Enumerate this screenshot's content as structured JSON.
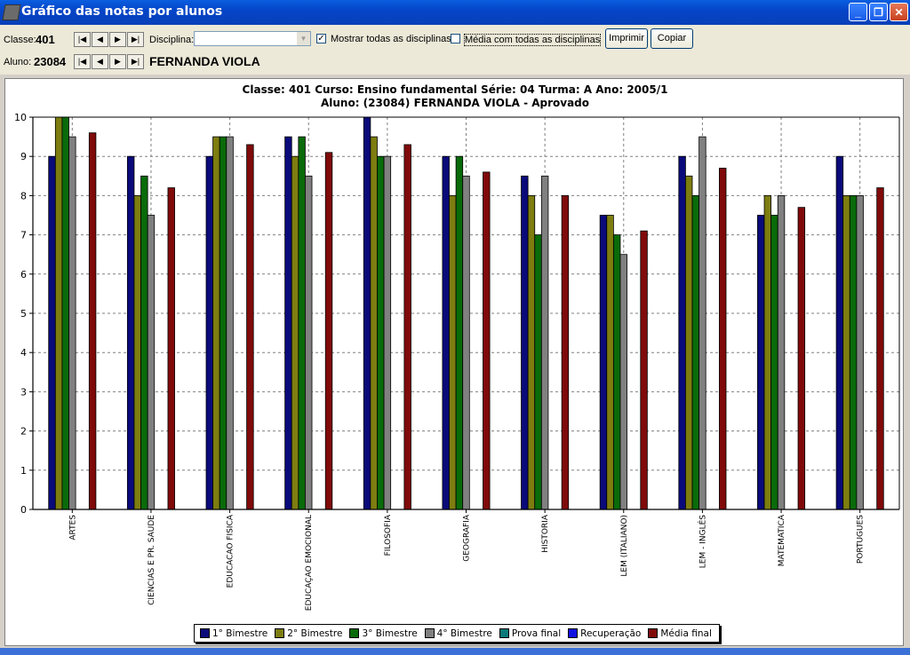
{
  "window": {
    "title": "Gráfico das notas por alunos"
  },
  "toolbar": {
    "classe_label": "Classe:",
    "classe_value": "401",
    "disciplina_label": "Disciplina:",
    "disciplina_value": "",
    "mostrar_label": "Mostrar todas as disciplinas",
    "mostrar_checked": true,
    "media_label": "Média com todas as disciplinas",
    "media_checked": false,
    "imprimir_label": "Imprimir",
    "copiar_label": "Copiar",
    "aluno_label": "Aluno:",
    "aluno_value": "23084",
    "aluno_name": "FERNANDA VIOLA"
  },
  "chart_data": {
    "type": "bar",
    "title_line1": "Classe: 401     Curso: Ensino fundamental     Série: 04     Turma: A     Ano: 2005/1",
    "title_line2": "Aluno: (23084) FERNANDA VIOLA - Aprovado",
    "ylim": [
      0,
      10
    ],
    "yticks": [
      "0",
      "1",
      "2",
      "3",
      "4",
      "5",
      "6",
      "7",
      "8",
      "9",
      "10"
    ],
    "grid": true,
    "legend_position": "bottom",
    "categories": [
      "ARTES",
      "CIENCIAS E PR. SAUDE",
      "EDUCACAO FISICA",
      "EDUCAÇAO EMOCIONAL",
      "FILOSOFIA",
      "GEOGRAFIA",
      "HISTORIA",
      "LEM (ITALIANO)",
      "LEM - INGLÊS",
      "MATEMATICA",
      "PORTUGUES"
    ],
    "series": [
      {
        "name": "1° Bimestre",
        "color": "#0a0a7a",
        "values": [
          9,
          9,
          9,
          9.5,
          10,
          9,
          8.5,
          7.5,
          9,
          7.5,
          9
        ]
      },
      {
        "name": "2° Bimestre",
        "color": "#7d7d10",
        "values": [
          10,
          8,
          9.5,
          9,
          9.5,
          8,
          8,
          7.5,
          8.5,
          8,
          8
        ]
      },
      {
        "name": "3° Bimestre",
        "color": "#0a6b0a",
        "values": [
          10,
          8.5,
          9.5,
          9.5,
          9,
          9,
          7,
          7,
          8,
          7.5,
          8
        ]
      },
      {
        "name": "4° Bimestre",
        "color": "#808080",
        "values": [
          9.5,
          7.5,
          9.5,
          8.5,
          9,
          8.5,
          8.5,
          6.5,
          9.5,
          8,
          8
        ]
      },
      {
        "name": "Prova final",
        "color": "#0a7a7a",
        "values": [
          0,
          0,
          0,
          0,
          0,
          0,
          0,
          0,
          0,
          0,
          0
        ]
      },
      {
        "name": "Recuperação",
        "color": "#1010e0",
        "values": [
          0,
          0,
          0,
          0,
          0,
          0,
          0,
          0,
          0,
          0,
          0
        ]
      },
      {
        "name": "Média final",
        "color": "#800a0a",
        "values": [
          9.6,
          8.2,
          9.3,
          9.1,
          9.3,
          8.6,
          8,
          7.1,
          8.7,
          7.7,
          8.2
        ]
      }
    ]
  }
}
